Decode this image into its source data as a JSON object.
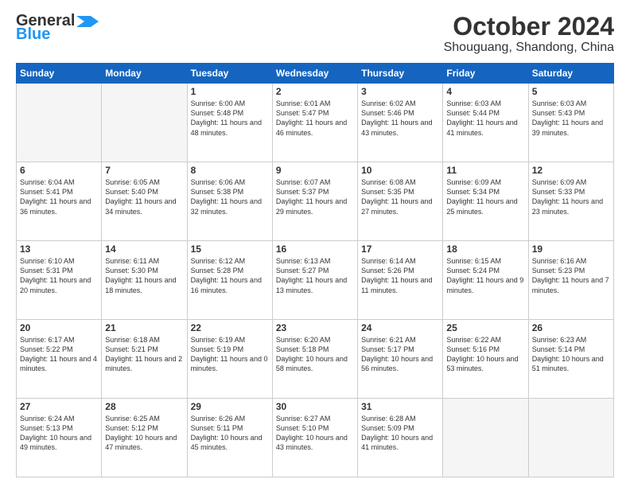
{
  "header": {
    "logo_line1": "General",
    "logo_line2": "Blue",
    "month": "October 2024",
    "location": "Shouguang, Shandong, China"
  },
  "days_of_week": [
    "Sunday",
    "Monday",
    "Tuesday",
    "Wednesday",
    "Thursday",
    "Friday",
    "Saturday"
  ],
  "weeks": [
    [
      {
        "day": "",
        "empty": true
      },
      {
        "day": "",
        "empty": true
      },
      {
        "day": "1",
        "sunrise": "6:00 AM",
        "sunset": "5:48 PM",
        "daylight": "11 hours and 48 minutes."
      },
      {
        "day": "2",
        "sunrise": "6:01 AM",
        "sunset": "5:47 PM",
        "daylight": "11 hours and 46 minutes."
      },
      {
        "day": "3",
        "sunrise": "6:02 AM",
        "sunset": "5:46 PM",
        "daylight": "11 hours and 43 minutes."
      },
      {
        "day": "4",
        "sunrise": "6:03 AM",
        "sunset": "5:44 PM",
        "daylight": "11 hours and 41 minutes."
      },
      {
        "day": "5",
        "sunrise": "6:03 AM",
        "sunset": "5:43 PM",
        "daylight": "11 hours and 39 minutes."
      }
    ],
    [
      {
        "day": "6",
        "sunrise": "6:04 AM",
        "sunset": "5:41 PM",
        "daylight": "11 hours and 36 minutes."
      },
      {
        "day": "7",
        "sunrise": "6:05 AM",
        "sunset": "5:40 PM",
        "daylight": "11 hours and 34 minutes."
      },
      {
        "day": "8",
        "sunrise": "6:06 AM",
        "sunset": "5:38 PM",
        "daylight": "11 hours and 32 minutes."
      },
      {
        "day": "9",
        "sunrise": "6:07 AM",
        "sunset": "5:37 PM",
        "daylight": "11 hours and 29 minutes."
      },
      {
        "day": "10",
        "sunrise": "6:08 AM",
        "sunset": "5:35 PM",
        "daylight": "11 hours and 27 minutes."
      },
      {
        "day": "11",
        "sunrise": "6:09 AM",
        "sunset": "5:34 PM",
        "daylight": "11 hours and 25 minutes."
      },
      {
        "day": "12",
        "sunrise": "6:09 AM",
        "sunset": "5:33 PM",
        "daylight": "11 hours and 23 minutes."
      }
    ],
    [
      {
        "day": "13",
        "sunrise": "6:10 AM",
        "sunset": "5:31 PM",
        "daylight": "11 hours and 20 minutes."
      },
      {
        "day": "14",
        "sunrise": "6:11 AM",
        "sunset": "5:30 PM",
        "daylight": "11 hours and 18 minutes."
      },
      {
        "day": "15",
        "sunrise": "6:12 AM",
        "sunset": "5:28 PM",
        "daylight": "11 hours and 16 minutes."
      },
      {
        "day": "16",
        "sunrise": "6:13 AM",
        "sunset": "5:27 PM",
        "daylight": "11 hours and 13 minutes."
      },
      {
        "day": "17",
        "sunrise": "6:14 AM",
        "sunset": "5:26 PM",
        "daylight": "11 hours and 11 minutes."
      },
      {
        "day": "18",
        "sunrise": "6:15 AM",
        "sunset": "5:24 PM",
        "daylight": "11 hours and 9 minutes."
      },
      {
        "day": "19",
        "sunrise": "6:16 AM",
        "sunset": "5:23 PM",
        "daylight": "11 hours and 7 minutes."
      }
    ],
    [
      {
        "day": "20",
        "sunrise": "6:17 AM",
        "sunset": "5:22 PM",
        "daylight": "11 hours and 4 minutes."
      },
      {
        "day": "21",
        "sunrise": "6:18 AM",
        "sunset": "5:21 PM",
        "daylight": "11 hours and 2 minutes."
      },
      {
        "day": "22",
        "sunrise": "6:19 AM",
        "sunset": "5:19 PM",
        "daylight": "11 hours and 0 minutes."
      },
      {
        "day": "23",
        "sunrise": "6:20 AM",
        "sunset": "5:18 PM",
        "daylight": "10 hours and 58 minutes."
      },
      {
        "day": "24",
        "sunrise": "6:21 AM",
        "sunset": "5:17 PM",
        "daylight": "10 hours and 56 minutes."
      },
      {
        "day": "25",
        "sunrise": "6:22 AM",
        "sunset": "5:16 PM",
        "daylight": "10 hours and 53 minutes."
      },
      {
        "day": "26",
        "sunrise": "6:23 AM",
        "sunset": "5:14 PM",
        "daylight": "10 hours and 51 minutes."
      }
    ],
    [
      {
        "day": "27",
        "sunrise": "6:24 AM",
        "sunset": "5:13 PM",
        "daylight": "10 hours and 49 minutes."
      },
      {
        "day": "28",
        "sunrise": "6:25 AM",
        "sunset": "5:12 PM",
        "daylight": "10 hours and 47 minutes."
      },
      {
        "day": "29",
        "sunrise": "6:26 AM",
        "sunset": "5:11 PM",
        "daylight": "10 hours and 45 minutes."
      },
      {
        "day": "30",
        "sunrise": "6:27 AM",
        "sunset": "5:10 PM",
        "daylight": "10 hours and 43 minutes."
      },
      {
        "day": "31",
        "sunrise": "6:28 AM",
        "sunset": "5:09 PM",
        "daylight": "10 hours and 41 minutes."
      },
      {
        "day": "",
        "empty": true
      },
      {
        "day": "",
        "empty": true
      }
    ]
  ]
}
